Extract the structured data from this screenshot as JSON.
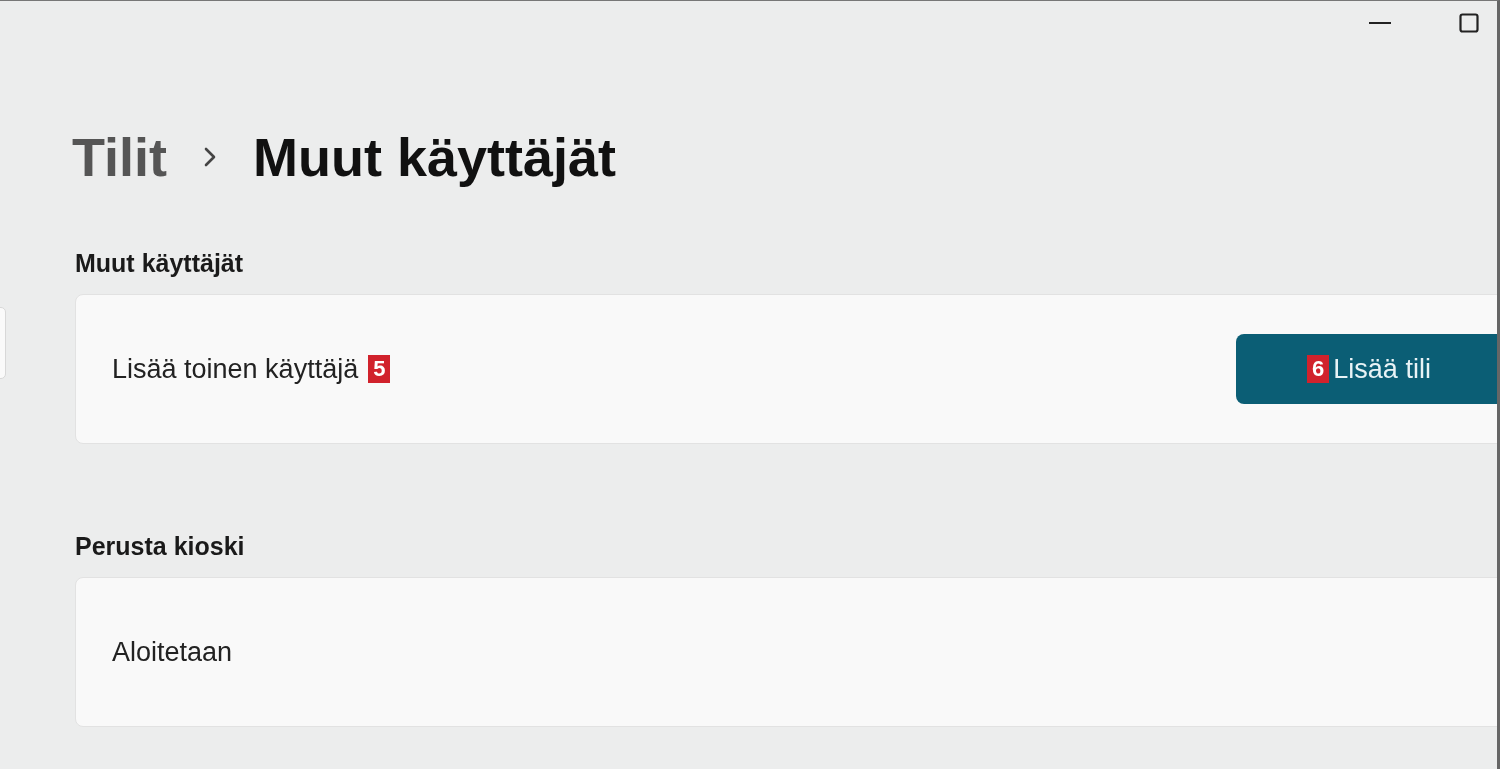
{
  "window": {
    "controls": [
      {
        "kind": "minimize"
      },
      {
        "kind": "maximize"
      }
    ]
  },
  "breadcrumb": {
    "parent": "Tilit",
    "current": "Muut käyttäjät"
  },
  "sections": [
    {
      "heading": "Muut käyttäjät",
      "row": {
        "label": "Lisää toinen käyttäjä",
        "marker": "5",
        "button": {
          "label": "Lisää tili",
          "marker": "6"
        }
      }
    },
    {
      "heading": "Perusta kioski",
      "row": {
        "label": "Aloitetaan"
      }
    }
  ]
}
